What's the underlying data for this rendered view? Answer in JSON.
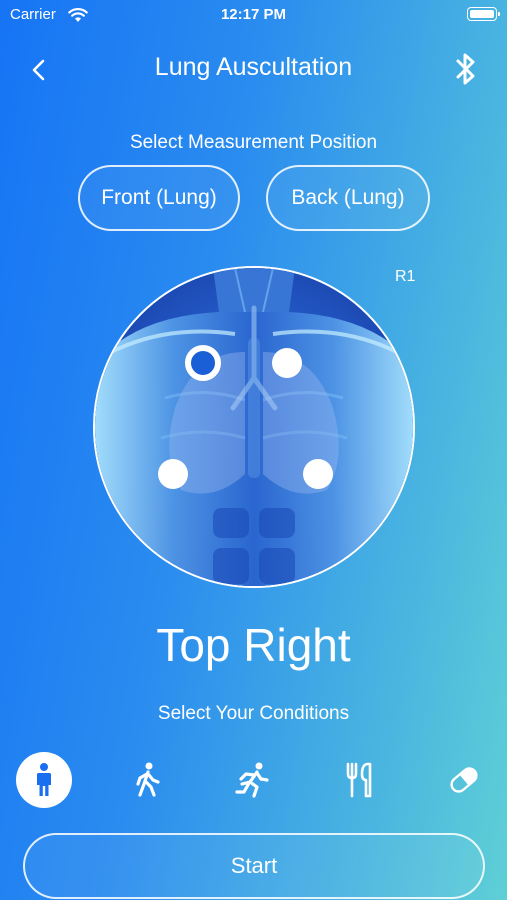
{
  "status_bar": {
    "carrier": "Carrier",
    "time": "12:17 PM"
  },
  "header": {
    "title": "Lung Auscultation",
    "back_icon": "chevron-left-icon",
    "bluetooth_icon": "bluetooth-icon"
  },
  "measurement": {
    "label": "Select Measurement Position",
    "options": [
      {
        "label": "Front (Lung)"
      },
      {
        "label": "Back (Lung)"
      }
    ],
    "image_label": "R1",
    "points": [
      {
        "id": "top-right",
        "selected": true
      },
      {
        "id": "top-left",
        "selected": false
      },
      {
        "id": "bottom-right",
        "selected": false
      },
      {
        "id": "bottom-left",
        "selected": false
      }
    ],
    "selected_position": "Top Right"
  },
  "conditions": {
    "label": "Select Your Conditions",
    "items": [
      {
        "icon": "standing-person-icon",
        "selected": true
      },
      {
        "icon": "walking-person-icon",
        "selected": false
      },
      {
        "icon": "running-person-icon",
        "selected": false
      },
      {
        "icon": "fork-knife-icon",
        "selected": false
      },
      {
        "icon": "pill-icon",
        "selected": false
      }
    ]
  },
  "start_label": "Start",
  "colors": {
    "accent": "#1a6ff0",
    "point_active": "#1a5fd6"
  }
}
